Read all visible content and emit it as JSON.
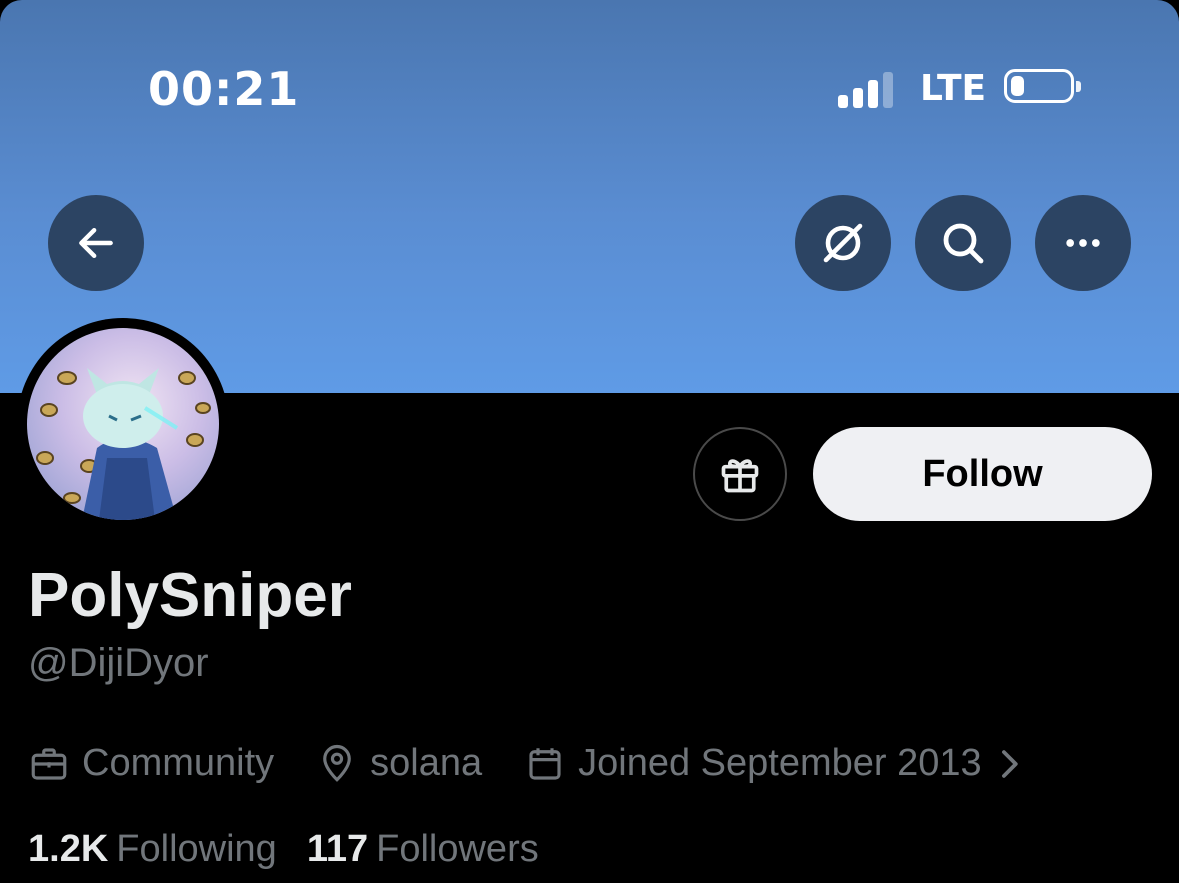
{
  "status_bar": {
    "time": "00:21",
    "network": "LTE",
    "battery_level_fraction": 0.15
  },
  "nav": {
    "back_icon": "arrow-left-icon",
    "grok_icon": "grok-slash-circle-icon",
    "search_icon": "search-icon",
    "more_icon": "more-horizontal-icon"
  },
  "profile": {
    "display_name": "PolySniper",
    "handle": "@DijiDyor",
    "category": "Community",
    "location": "solana",
    "joined": "Joined September 2013",
    "following_count": "1.2K",
    "following_label": "Following",
    "followers_count": "117",
    "followers_label": "Followers"
  },
  "actions": {
    "follow_label": "Follow",
    "gift_icon": "gift-icon"
  },
  "colors": {
    "banner": "#5a8dd2",
    "nav_button_bg": "#2c4463",
    "background": "#000000",
    "follow_button_bg": "#eff0f3",
    "secondary_text": "#71767b",
    "primary_text": "#e7e9ea"
  }
}
